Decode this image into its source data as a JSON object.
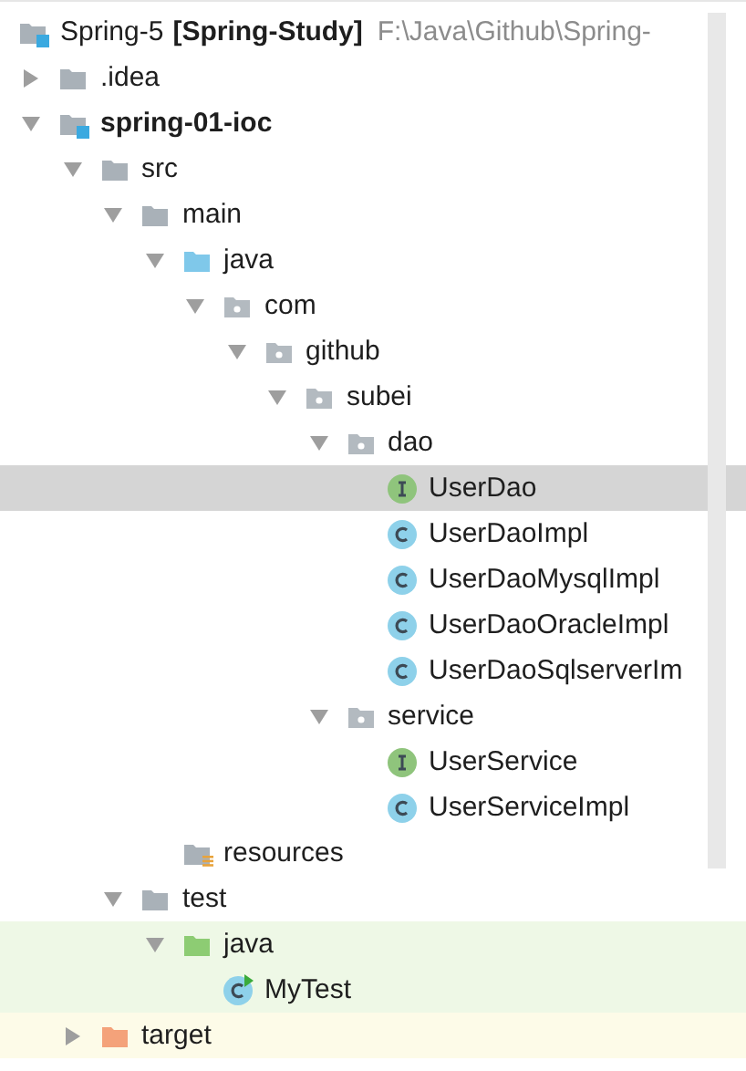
{
  "tree": {
    "name": "Spring-5",
    "tag": "[Spring-Study]",
    "path": "F:\\Java\\Github\\Spring-",
    "kind": "project",
    "selected": false,
    "children": [
      {
        "name": ".idea",
        "kind": "folder",
        "expanded": false,
        "selected": false
      },
      {
        "name": "spring-01-ioc",
        "kind": "module",
        "expanded": true,
        "selected": false,
        "children": [
          {
            "name": "src",
            "kind": "folder",
            "expanded": true,
            "selected": false,
            "children": [
              {
                "name": "main",
                "kind": "folder",
                "expanded": true,
                "selected": false,
                "children": [
                  {
                    "name": "java",
                    "kind": "source-folder",
                    "expanded": true,
                    "selected": false,
                    "children": [
                      {
                        "name": "com",
                        "kind": "package",
                        "expanded": true,
                        "selected": false,
                        "children": [
                          {
                            "name": "github",
                            "kind": "package",
                            "expanded": true,
                            "selected": false,
                            "children": [
                              {
                                "name": "subei",
                                "kind": "package",
                                "expanded": true,
                                "selected": false,
                                "children": [
                                  {
                                    "name": "dao",
                                    "kind": "package",
                                    "expanded": true,
                                    "selected": false,
                                    "children": [
                                      {
                                        "name": "UserDao",
                                        "kind": "interface",
                                        "selected": true
                                      },
                                      {
                                        "name": "UserDaoImpl",
                                        "kind": "class",
                                        "selected": false
                                      },
                                      {
                                        "name": "UserDaoMysqlImpl",
                                        "kind": "class",
                                        "selected": false
                                      },
                                      {
                                        "name": "UserDaoOracleImpl",
                                        "kind": "class",
                                        "selected": false
                                      },
                                      {
                                        "name": "UserDaoSqlserverIm",
                                        "kind": "class",
                                        "selected": false
                                      }
                                    ]
                                  },
                                  {
                                    "name": "service",
                                    "kind": "package",
                                    "expanded": true,
                                    "selected": false,
                                    "children": [
                                      {
                                        "name": "UserService",
                                        "kind": "interface",
                                        "selected": false
                                      },
                                      {
                                        "name": "UserServiceImpl",
                                        "kind": "class",
                                        "selected": false
                                      }
                                    ]
                                  }
                                ]
                              }
                            ]
                          }
                        ]
                      }
                    ]
                  },
                  {
                    "name": "resources",
                    "kind": "resources-folder",
                    "selected": false
                  }
                ]
              },
              {
                "name": "test",
                "kind": "folder",
                "expanded": true,
                "selected": false,
                "children": [
                  {
                    "name": "java",
                    "kind": "test-folder",
                    "color": "#eef8e6",
                    "expanded": true,
                    "selected": false,
                    "children": [
                      {
                        "name": "MyTest",
                        "kind": "test-class",
                        "color": "#eef8e6",
                        "selected": false
                      }
                    ]
                  }
                ]
              }
            ]
          },
          {
            "name": "target",
            "kind": "excluded-folder",
            "color": "#fdfbe8",
            "expanded": false,
            "selected": false
          }
        ]
      }
    ]
  }
}
